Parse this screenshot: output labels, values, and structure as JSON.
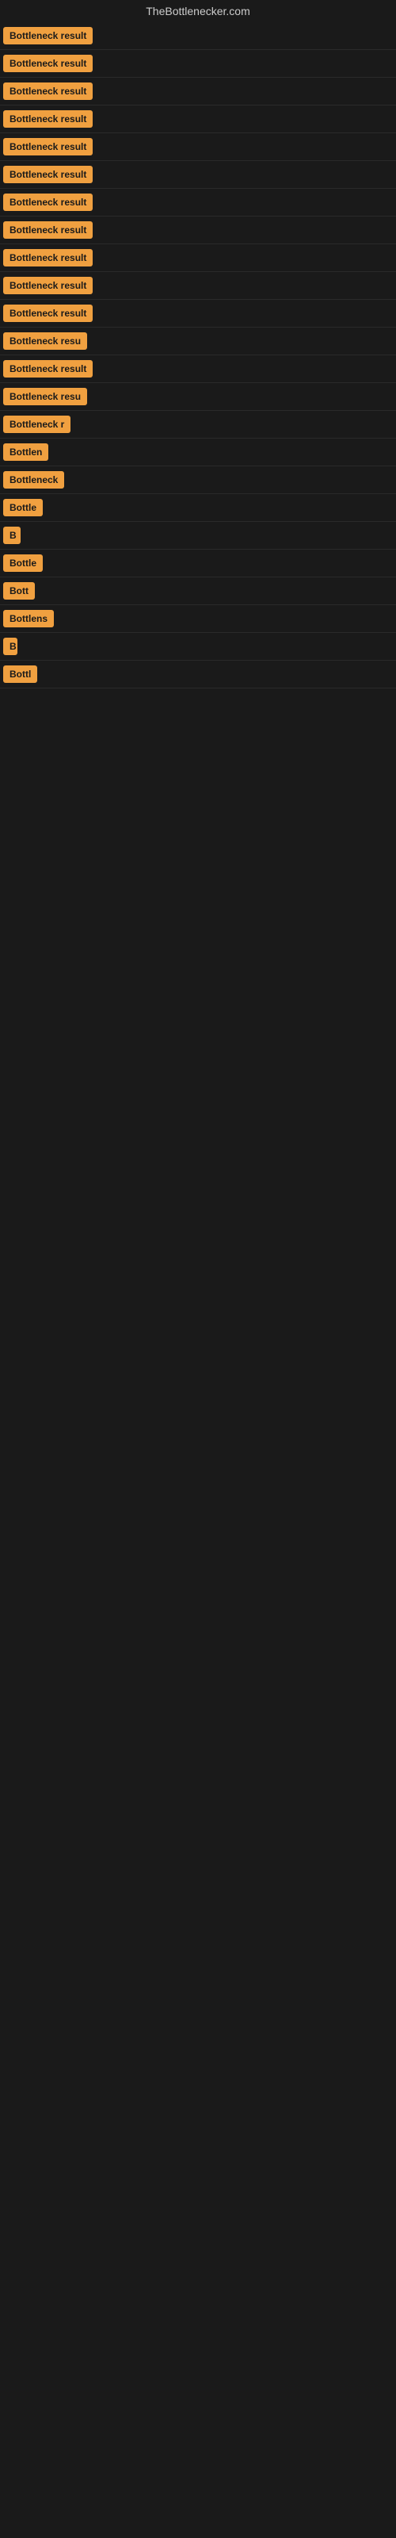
{
  "site": {
    "title": "TheBottlenecker.com"
  },
  "rows": [
    {
      "id": 1,
      "badge_text": "Bottleneck result",
      "clip_width": 120
    },
    {
      "id": 2,
      "badge_text": "Bottleneck result",
      "clip_width": 120
    },
    {
      "id": 3,
      "badge_text": "Bottleneck result",
      "clip_width": 120
    },
    {
      "id": 4,
      "badge_text": "Bottleneck result",
      "clip_width": 120
    },
    {
      "id": 5,
      "badge_text": "Bottleneck result",
      "clip_width": 120
    },
    {
      "id": 6,
      "badge_text": "Bottleneck result",
      "clip_width": 120
    },
    {
      "id": 7,
      "badge_text": "Bottleneck result",
      "clip_width": 120
    },
    {
      "id": 8,
      "badge_text": "Bottleneck result",
      "clip_width": 120
    },
    {
      "id": 9,
      "badge_text": "Bottleneck result",
      "clip_width": 120
    },
    {
      "id": 10,
      "badge_text": "Bottleneck result",
      "clip_width": 120
    },
    {
      "id": 11,
      "badge_text": "Bottleneck result",
      "clip_width": 120
    },
    {
      "id": 12,
      "badge_text": "Bottleneck resu",
      "clip_width": 110
    },
    {
      "id": 13,
      "badge_text": "Bottleneck result",
      "clip_width": 115
    },
    {
      "id": 14,
      "badge_text": "Bottleneck resu",
      "clip_width": 108
    },
    {
      "id": 15,
      "badge_text": "Bottleneck r",
      "clip_width": 95
    },
    {
      "id": 16,
      "badge_text": "Bottlen",
      "clip_width": 72
    },
    {
      "id": 17,
      "badge_text": "Bottleneck",
      "clip_width": 80
    },
    {
      "id": 18,
      "badge_text": "Bottle",
      "clip_width": 58
    },
    {
      "id": 19,
      "badge_text": "B",
      "clip_width": 22
    },
    {
      "id": 20,
      "badge_text": "Bottle",
      "clip_width": 58
    },
    {
      "id": 21,
      "badge_text": "Bott",
      "clip_width": 44
    },
    {
      "id": 22,
      "badge_text": "Bottlens",
      "clip_width": 68
    },
    {
      "id": 23,
      "badge_text": "B",
      "clip_width": 18
    },
    {
      "id": 24,
      "badge_text": "Bottl",
      "clip_width": 50
    }
  ],
  "colors": {
    "badge_bg": "#f0a040",
    "badge_text": "#1a1a1a",
    "background": "#1a1a1a",
    "title": "#cccccc"
  }
}
